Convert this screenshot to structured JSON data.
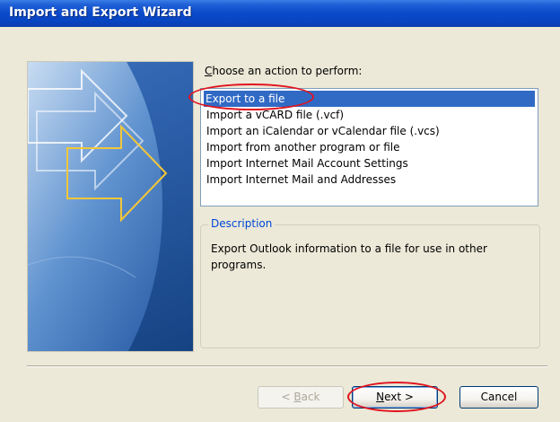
{
  "window": {
    "title": "Import and Export Wizard"
  },
  "prompt": {
    "text_pre": "",
    "text_key": "C",
    "text_post": "hoose an action to perform:"
  },
  "actions": [
    {
      "label": "Export to a file",
      "selected": true
    },
    {
      "label": "Import a vCARD file (.vcf)",
      "selected": false
    },
    {
      "label": "Import an iCalendar or vCalendar file (.vcs)",
      "selected": false
    },
    {
      "label": "Import from another program or file",
      "selected": false
    },
    {
      "label": "Import Internet Mail Account Settings",
      "selected": false
    },
    {
      "label": "Import Internet Mail and Addresses",
      "selected": false
    }
  ],
  "description": {
    "legend": "Description",
    "text": "Export Outlook information to a file for use in other programs."
  },
  "buttons": {
    "back": {
      "prefix": "< ",
      "key": "B",
      "rest": "ack",
      "enabled": false
    },
    "next": {
      "key": "N",
      "rest": "ext >",
      "enabled": true
    },
    "cancel": {
      "label": "Cancel",
      "enabled": true
    }
  },
  "colors": {
    "title_bar": "#0a49c9",
    "selection": "#316ac5",
    "group_legend": "#0046d5",
    "annotation": "#e0141e"
  }
}
